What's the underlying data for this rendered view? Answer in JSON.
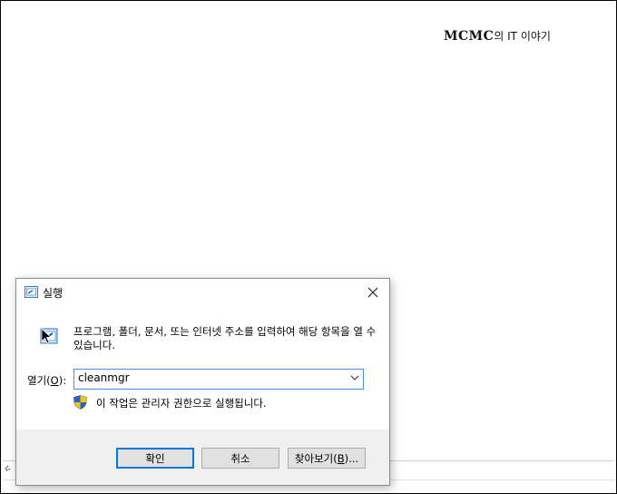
{
  "watermark": {
    "brand": "MCMC",
    "rest": "의 IT 이야기",
    "brand_text": "MCMC의 IT 이야기"
  },
  "dialog": {
    "title": "실행",
    "description": "프로그램, 폴더, 문서, 또는 인터넷 주소를 입력하여 해당 항목을 열 수 있습니다.",
    "open_label": "열기(O):",
    "open_label_prefix": "열기(",
    "open_label_accel": "O",
    "open_label_suffix": "):",
    "command_value": "cleanmgr",
    "admin_note": "이 작업은 관리자 권한으로 실행됩니다.",
    "buttons": {
      "ok": "확인",
      "cancel": "취소",
      "browse_prefix": "찾아보기(",
      "browse_accel": "B",
      "browse_suffix": ")..."
    }
  },
  "background_fragment": "ሩ",
  "colors": {
    "accent": "#0078d7",
    "footer": "#f0f0f0",
    "button": "#e1e1e1"
  },
  "icons": [
    "run-app-icon",
    "close-icon",
    "run-large-icon",
    "mouse-cursor-icon",
    "chevron-down-icon",
    "uac-shield-icon"
  ]
}
